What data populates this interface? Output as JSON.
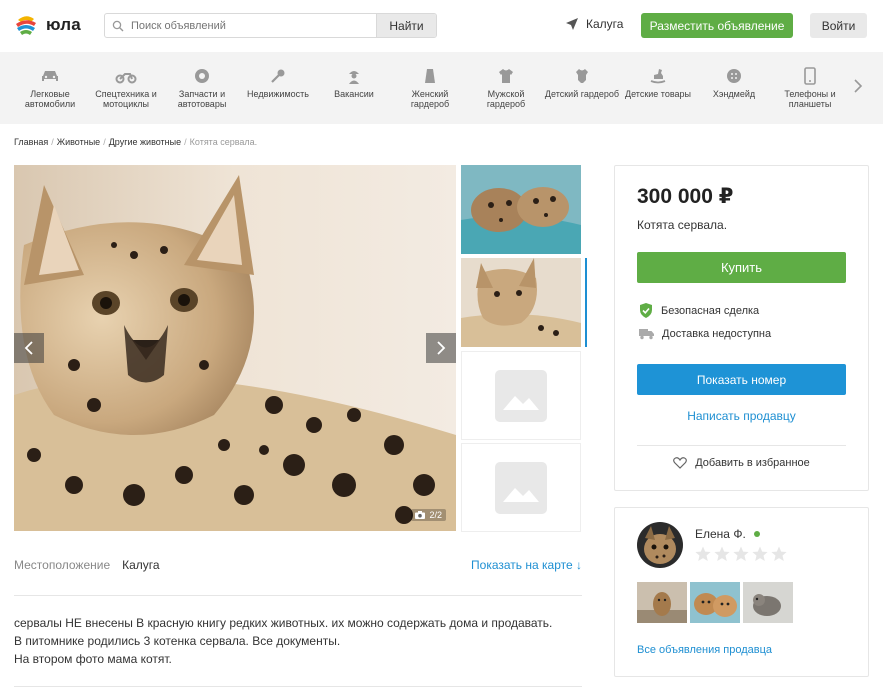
{
  "header": {
    "logo_text": "юла",
    "search_placeholder": "Поиск объявлений",
    "search_button": "Найти",
    "city": "Калуга",
    "post_button": "Разместить объявление",
    "login_button": "Войти"
  },
  "categories": [
    {
      "label": "Легковые автомобили",
      "icon": "car-icon"
    },
    {
      "label": "Спецтехника и мотоциклы",
      "icon": "motorcycle-icon"
    },
    {
      "label": "Запчасти и автотовары",
      "icon": "wheel-icon"
    },
    {
      "label": "Недвижимость",
      "icon": "key-icon"
    },
    {
      "label": "Вакансии",
      "icon": "worker-icon"
    },
    {
      "label": "Женский гардероб",
      "icon": "skirt-icon"
    },
    {
      "label": "Мужской гардероб",
      "icon": "shirt-icon"
    },
    {
      "label": "Детский гардероб",
      "icon": "onesie-icon"
    },
    {
      "label": "Детские товары",
      "icon": "rocking-horse-icon"
    },
    {
      "label": "Хэндмейд",
      "icon": "button-icon"
    },
    {
      "label": "Телефоны и планшеты",
      "icon": "phone-icon"
    }
  ],
  "breadcrumb": [
    "Главная",
    "Животные",
    "Другие животные",
    "Котята сервала."
  ],
  "gallery": {
    "counter": "2/2"
  },
  "location": {
    "label": "Местоположение",
    "value": "Калуга",
    "map_link": "Показать на карте ↓"
  },
  "description": [
    "сервалы НЕ внесены В красную книгу редких животных. их можно содержать дома и продавать.",
    "В питомнике родились 3 котенка сервала. Все документы.",
    "На втором фото мама котят."
  ],
  "offer": {
    "price": "300 000 ₽",
    "title": "Котята сервала.",
    "buy_button": "Купить",
    "safe_deal": "Безопасная сделка",
    "delivery": "Доставка недоступна",
    "phone_button": "Показать номер",
    "write_link": "Написать продавцу",
    "favorite": "Добавить в избранное"
  },
  "seller": {
    "name": "Елена Ф.",
    "rating": 0,
    "all_ads_link": "Все объявления продавца"
  },
  "colors": {
    "green": "#5fad45",
    "blue": "#1e93d6",
    "link": "#1e8fd2"
  }
}
